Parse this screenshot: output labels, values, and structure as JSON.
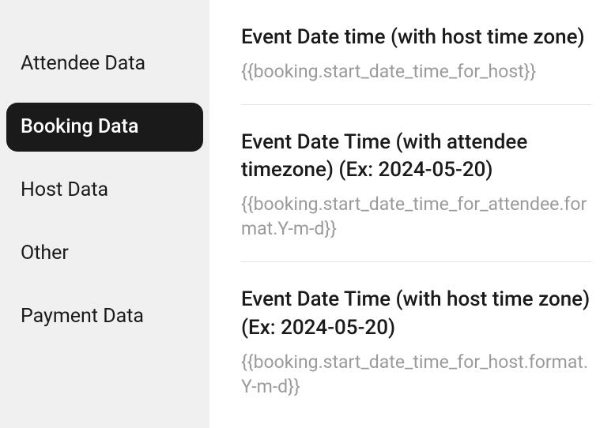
{
  "sidebar": {
    "items": [
      {
        "label": "Attendee Data",
        "active": false
      },
      {
        "label": "Booking Data",
        "active": true
      },
      {
        "label": "Host Data",
        "active": false
      },
      {
        "label": "Other",
        "active": false
      },
      {
        "label": "Payment Data",
        "active": false
      }
    ]
  },
  "content": {
    "items": [
      {
        "title": "Event Date time (with host time zone)",
        "code": "{{booking.start_date_time_for_host}}"
      },
      {
        "title": "Event Date Time (with attendee timezone) (Ex: 2024-05-20)",
        "code": "{{booking.start_date_time_for_attendee.format.Y-m-d}}"
      },
      {
        "title": "Event Date Time (with host time zone) (Ex: 2024-05-20)",
        "code": "{{booking.start_date_time_for_host.format.Y-m-d}}"
      }
    ]
  }
}
